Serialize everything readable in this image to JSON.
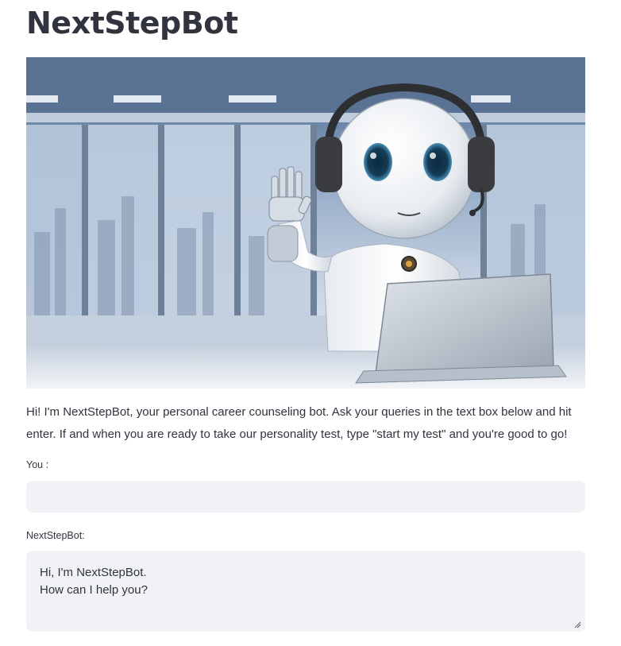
{
  "app": {
    "title": "NextStepBot"
  },
  "hero_image": {
    "description_icon": "robot-with-headset-and-laptop-image"
  },
  "intro": {
    "text": "Hi! I'm NextStepBot, your personal career counseling bot. Ask your queries in the text box below and hit enter. If and when you are ready to take our personality test, type \"start my test\" and you're good to go!"
  },
  "user_input": {
    "label": "You :",
    "value": "",
    "placeholder": ""
  },
  "bot_output": {
    "label": "NextStepBot:",
    "value": "Hi, I'm NextStepBot.\nHow can I help you?"
  },
  "colors": {
    "text": "#31333f",
    "input_bg": "#f0f2f6",
    "background": "#ffffff"
  }
}
